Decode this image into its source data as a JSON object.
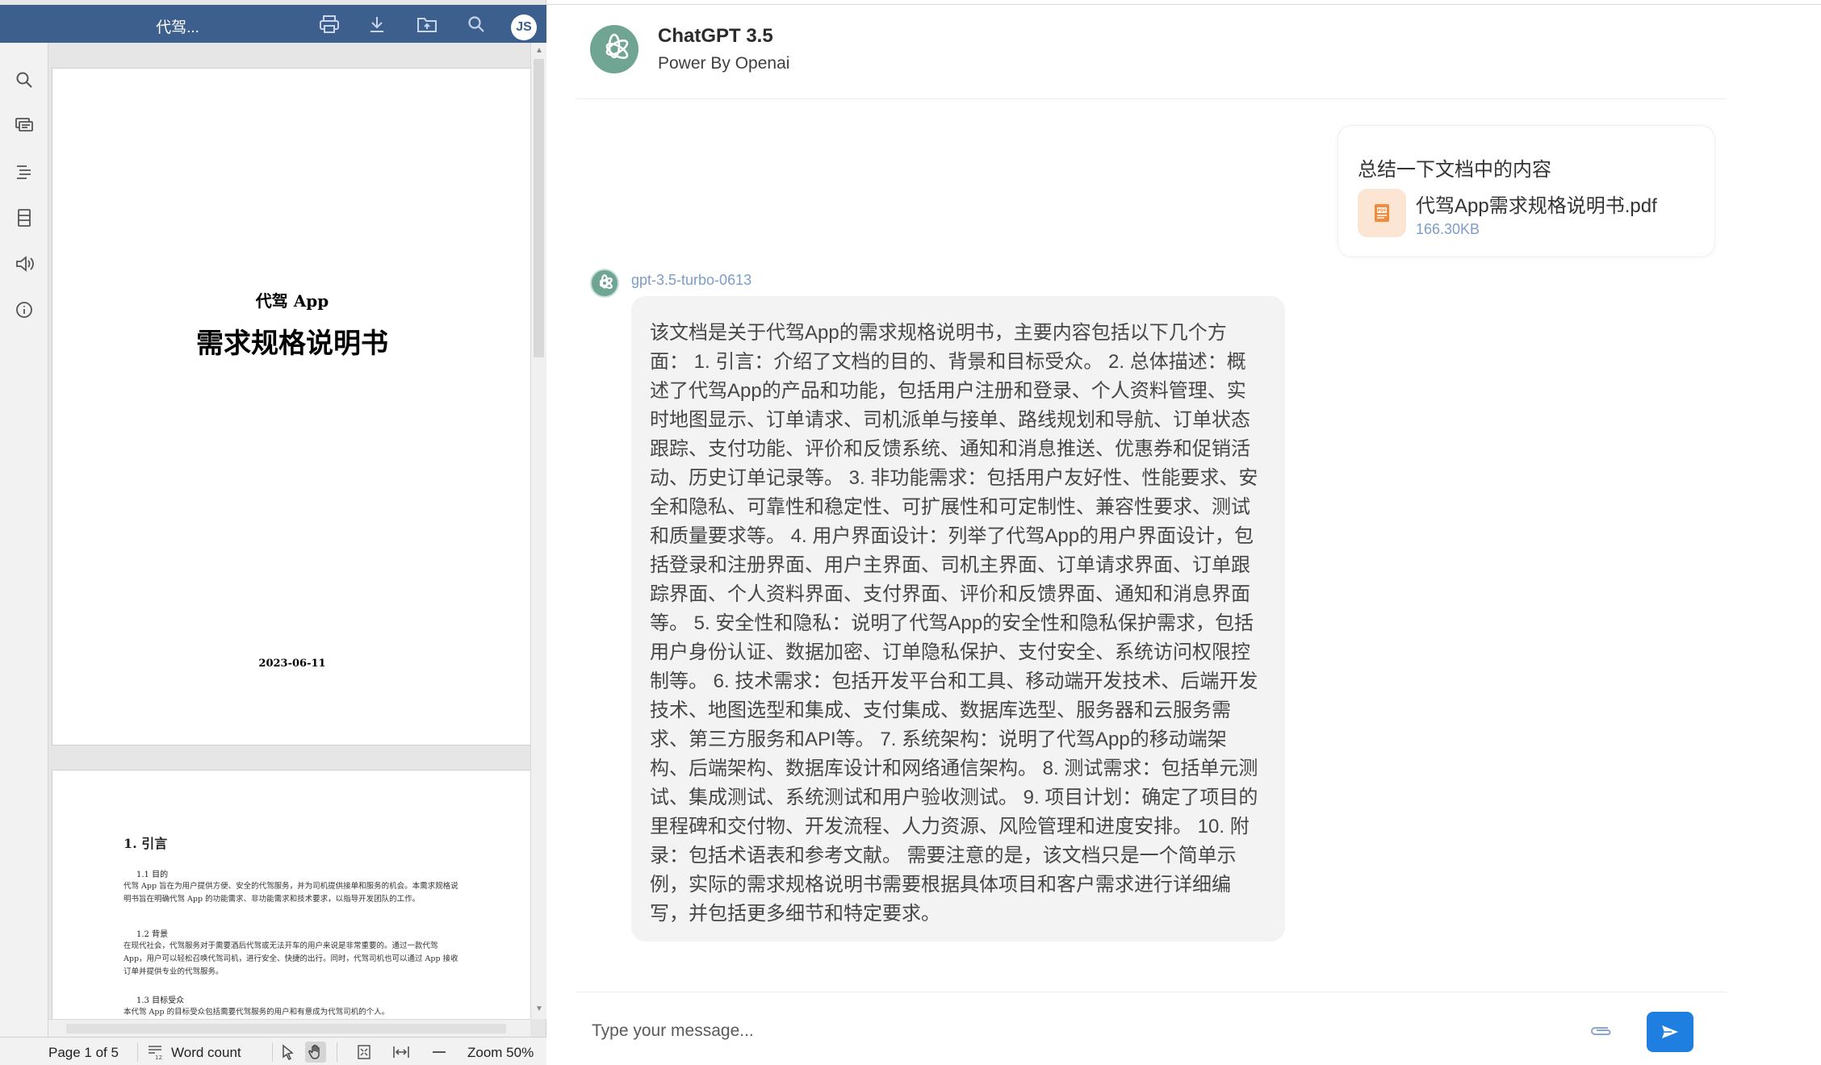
{
  "viewer": {
    "doc_title": "代驾...",
    "toolbar_icons": [
      "print-icon",
      "download-icon",
      "folder-icon",
      "search-icon"
    ],
    "avatar_initials": "JS",
    "sidebar_icons": [
      "search-icon",
      "comments-icon",
      "outline-icon",
      "thumbnails-icon",
      "audio-icon",
      "info-icon"
    ],
    "page1": {
      "line1": "代驾 App",
      "line2": "需求规格说明书",
      "date": "2023-06-11"
    },
    "page2": {
      "heading": "1.  引言",
      "s1_title": "1.1 目的",
      "s1_text": "代驾 App 旨在为用户提供方便、安全的代驾服务，并为司机提供接单和服务的机会。本需求规格说明书旨在明确代驾 App 的功能需求、非功能需求和技术要求，以指导开发团队的工作。",
      "s2_title": "1.2 背景",
      "s2_text": "在现代社会，代驾服务对于需要酒后代驾或无法开车的用户来说是非常重要的。通过一款代驾 App，用户可以轻松召唤代驾司机，进行安全、快捷的出行。同时，代驾司机也可以通过 App 接收订单并提供专业的代驾服务。",
      "s3_title": "1.3 目标受众",
      "s3_text": "本代驾 App 的目标受众包括需要代驾服务的用户和有意成为代驾司机的个人。"
    },
    "status": {
      "page": "Page 1 of 5",
      "word_count": "Word count",
      "zoom": "Zoom 50%"
    }
  },
  "chat": {
    "header": {
      "title": "ChatGPT 3.5",
      "subtitle": "Power By Openai"
    },
    "user_message": {
      "text": "总结一下文档中的内容",
      "file_name": "代驾App需求规格说明书.pdf",
      "file_size": "166.30KB"
    },
    "bot_message": {
      "model": "gpt-3.5-turbo-0613",
      "text": "该文档是关于代驾App的需求规格说明书，主要内容包括以下几个方面： 1. 引言：介绍了文档的目的、背景和目标受众。 2. 总体描述：概述了代驾App的产品和功能，包括用户注册和登录、个人资料管理、实时地图显示、订单请求、司机派单与接单、路线规划和导航、订单状态跟踪、支付功能、评价和反馈系统、通知和消息推送、优惠券和促销活动、历史订单记录等。 3. 非功能需求：包括用户友好性、性能要求、安全和隐私、可靠性和稳定性、可扩展性和可定制性、兼容性要求、测试和质量要求等。 4. 用户界面设计：列举了代驾App的用户界面设计，包括登录和注册界面、用户主界面、司机主界面、订单请求界面、订单跟踪界面、个人资料界面、支付界面、评价和反馈界面、通知和消息界面等。 5. 安全性和隐私：说明了代驾App的安全性和隐私保护需求，包括用户身份认证、数据加密、订单隐私保护、支付安全、系统访问权限控制等。 6. 技术需求：包括开发平台和工具、移动端开发技术、后端开发技术、地图选型和集成、支付集成、数据库选型、服务器和云服务需求、第三方服务和API等。 7. 系统架构：说明了代驾App的移动端架构、后端架构、数据库设计和网络通信架构。 8. 测试需求：包括单元测试、集成测试、系统测试和用户验收测试。 9. 项目计划：确定了项目的里程碑和交付物、开发流程、人力资源、风险管理和进度安排。 10. 附录：包括术语表和参考文献。 需要注意的是，该文档只是一个简单示例，实际的需求规格说明书需要根据具体项目和客户需求进行详细编写，并包括更多细节和特定要求。"
    },
    "composer": {
      "placeholder": "Type your message..."
    },
    "colors": {
      "accent": "#1f7fe0",
      "brand": "#6fa592",
      "viewer_bar": "#3d5f8e"
    }
  }
}
